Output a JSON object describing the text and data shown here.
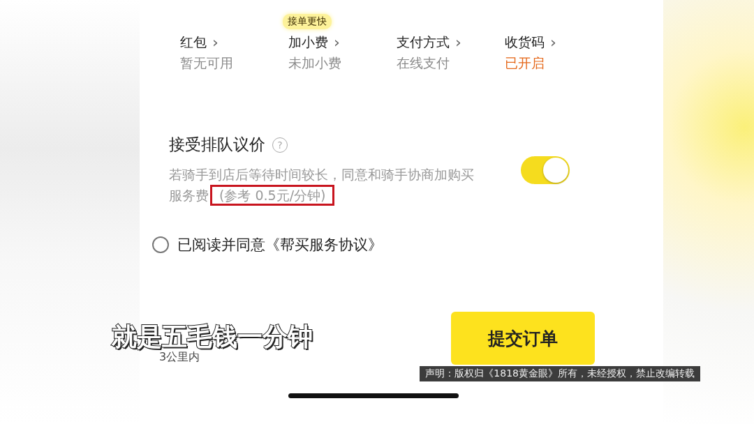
{
  "options": [
    {
      "label": "红包",
      "value": "暂无可用",
      "highlighted": false
    },
    {
      "label": "加小费",
      "value": "未加小费",
      "highlighted": false,
      "badge": "接单更快"
    },
    {
      "label": "支付方式",
      "value": "在线支付",
      "highlighted": false
    },
    {
      "label": "收货码",
      "value": "已开启",
      "highlighted": true
    }
  ],
  "chevron": "›",
  "queue_bargain": {
    "title": "接受排队议价",
    "help": "?",
    "description": "若骑手到店后等待时间较长，同意和骑手协商加购买服务费",
    "highlighted_note": "(参考 0.5元/分钟)",
    "on": true
  },
  "agreement": {
    "label": "已阅读并同意《帮买服务协议》",
    "checked": false
  },
  "distance": "3公里内",
  "submit_button": "提交订单",
  "subtitle": "就是五毛钱一分钟",
  "disclaimer": "声明：版权归《1818黄金眼》所有，未经授权，禁止改编转载"
}
